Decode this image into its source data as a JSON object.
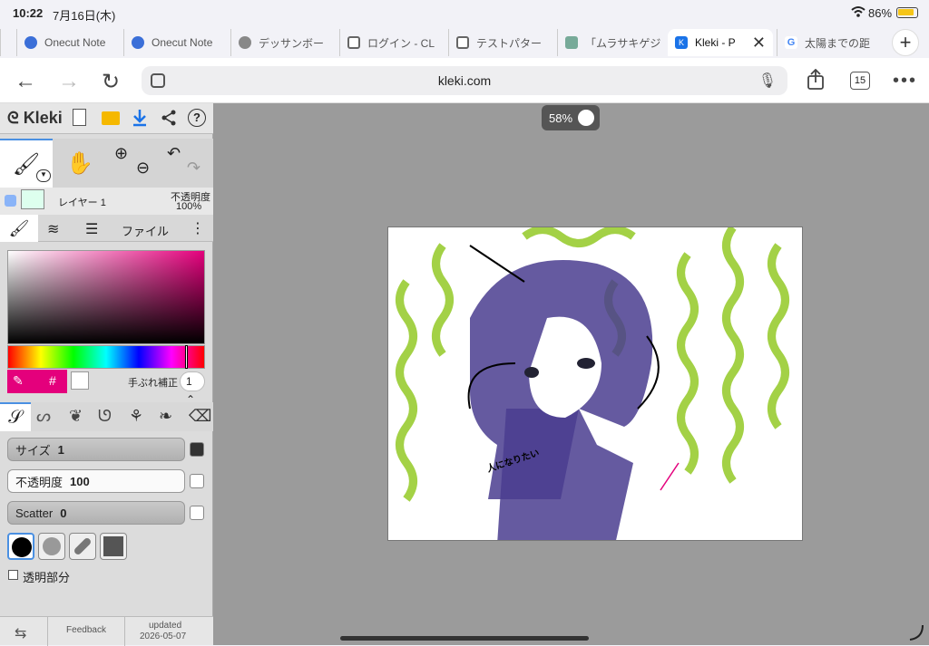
{
  "status": {
    "time": "10:22",
    "date": "7月16日(木)",
    "battery": "86%"
  },
  "tabs": [
    {
      "title": "Onecut Note",
      "icon": "onecut-icon"
    },
    {
      "title": "Onecut Note",
      "icon": "onecut-icon"
    },
    {
      "title": "デッサンボー",
      "icon": "globe-icon"
    },
    {
      "title": "ログイン - CL",
      "icon": "clip-icon"
    },
    {
      "title": "テストパター",
      "icon": "clip-icon"
    },
    {
      "title": "「ムラサキゲジ",
      "icon": "image-icon"
    },
    {
      "title": "Kleki - P",
      "icon": "kleki-icon",
      "active": true
    },
    {
      "title": "太陽までの距",
      "icon": "google-icon"
    }
  ],
  "address": {
    "url": "kleki.com",
    "tab_count": "15"
  },
  "app": {
    "name": "Kleki",
    "layer_name": "レイヤー 1",
    "opacity_label": "不透明度",
    "opacity_value": "100%",
    "tab_file": "ファイル",
    "stabilizer_label": "手ぶれ補正",
    "stabilizer_value": "1",
    "size_label": "サイズ",
    "size_value": "1",
    "opacity_slider_label": "不透明度",
    "opacity_slider_value": "100",
    "scatter_label": "Scatter",
    "scatter_value": "0",
    "transparent_label": "透明部分",
    "feedback": "Feedback",
    "updated_label": "updated",
    "updated_date": "2026-05-07",
    "zoom": "58%",
    "accent": "#e4007c",
    "hash_glyph": "#",
    "canvas_text": "人になりたい"
  }
}
